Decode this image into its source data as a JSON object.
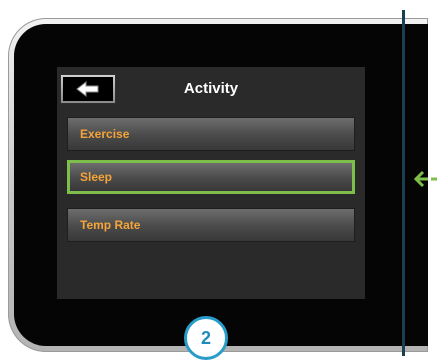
{
  "screen": {
    "title": "Activity",
    "back_button": {
      "icon": "arrow-left-icon"
    },
    "menu": [
      {
        "label": "Exercise",
        "selected": false
      },
      {
        "label": "Sleep",
        "selected": true
      },
      {
        "label": "Temp Rate",
        "selected": false
      }
    ]
  },
  "callout": {
    "step": "2"
  },
  "colors": {
    "label_text": "#f5a43a",
    "selection_outline": "#7dbf4a",
    "badge_accent": "#2a9cc9",
    "pointer_arrow": "#7dbf4a"
  }
}
